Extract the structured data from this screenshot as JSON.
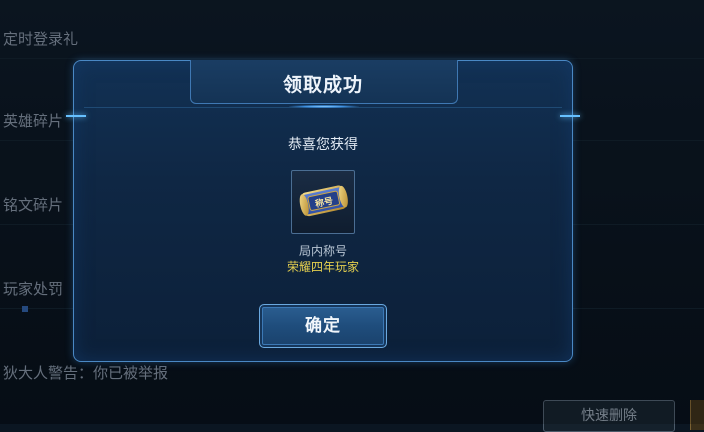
{
  "background": {
    "rows": [
      {
        "label": "定时登录礼"
      },
      {
        "label": "英雄碎片"
      },
      {
        "label": "铭文碎片"
      },
      {
        "label": "玩家处罚"
      },
      {
        "label": "狄大人警告：你已被举报"
      }
    ],
    "quick_delete_label": "快速删除"
  },
  "dialog": {
    "title": "领取成功",
    "subtitle": "恭喜您获得",
    "item": {
      "icon": "scroll-title-icon",
      "icon_text": "称号",
      "name": "局内称号",
      "title_text": "荣耀四年玩家"
    },
    "confirm_label": "确定"
  },
  "colors": {
    "accent_blue": "#4a88c4",
    "item_title_yellow": "#e5d04f"
  }
}
